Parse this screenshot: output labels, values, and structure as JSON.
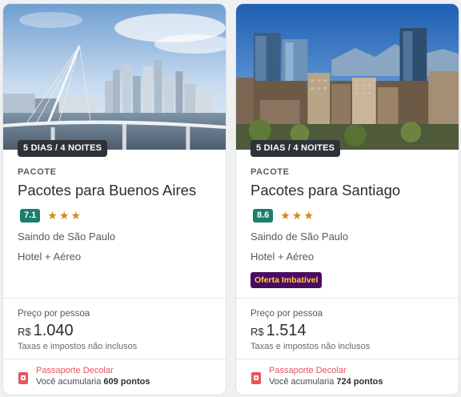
{
  "cards": [
    {
      "duration": "5 DIAS / 4 NOITES",
      "type": "PACOTE",
      "title": "Pacotes para Buenos Aires",
      "score": "7.1",
      "star_count": 3,
      "origin": "Saindo de São Paulo",
      "includes": "Hotel + Aéreo",
      "promo": null,
      "price_label": "Preço por pessoa",
      "currency": "R$",
      "price": "1.040",
      "taxes_note": "Taxas e impostos não inclusos",
      "loyalty_title": "Passaporte Decolar",
      "loyalty_prefix": "Você acumularia",
      "loyalty_points": "609 pontos"
    },
    {
      "duration": "5 DIAS / 4 NOITES",
      "type": "PACOTE",
      "title": "Pacotes para Santiago",
      "score": "8.6",
      "star_count": 3,
      "origin": "Saindo de São Paulo",
      "includes": "Hotel + Aéreo",
      "promo": "Oferta Imbatível",
      "price_label": "Preço por pessoa",
      "currency": "R$",
      "price": "1.514",
      "taxes_note": "Taxas e impostos não inclusos",
      "loyalty_title": "Passaporte Decolar",
      "loyalty_prefix": "Você acumularia",
      "loyalty_points": "724 pontos"
    }
  ],
  "icons": {
    "star": "star-icon",
    "loyalty": "passport-icon"
  },
  "colors": {
    "score_bg": "#1a7f6c",
    "star": "#d4891c",
    "promo_bg": "#4b0b63",
    "promo_text": "#ffd23c",
    "loyalty_accent": "#e8555b",
    "badge_bg": "#2f3338"
  }
}
